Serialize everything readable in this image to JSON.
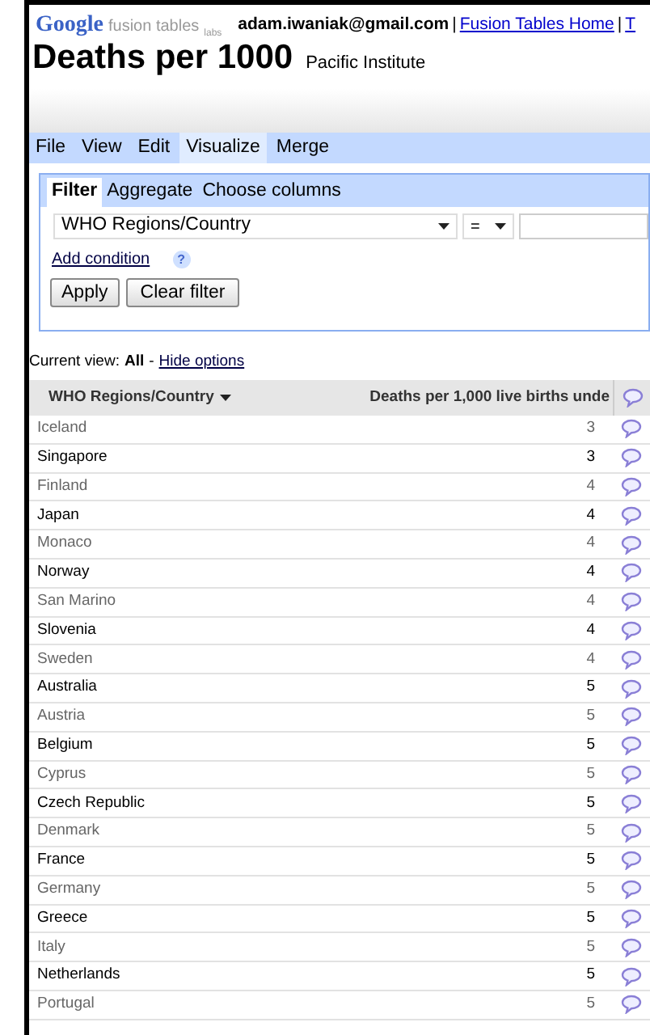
{
  "header": {
    "user": "adam.iwaniak@gmail.com",
    "separator": "|",
    "links": [
      "Fusion Tables Home",
      "T"
    ]
  },
  "logo": {
    "brand": "Google",
    "product": "fusion tables",
    "tag": "labs"
  },
  "title": "Deaths per 1000",
  "subtitle": "Pacific Institute",
  "menu": [
    {
      "label": "File",
      "selected": false
    },
    {
      "label": "View",
      "selected": false
    },
    {
      "label": "Edit",
      "selected": false
    },
    {
      "label": "Visualize",
      "selected": true
    },
    {
      "label": "Merge",
      "selected": false
    }
  ],
  "options_tabs": [
    {
      "label": "Filter",
      "selected": true
    },
    {
      "label": "Aggregate",
      "selected": false
    },
    {
      "label": "Choose columns",
      "selected": false
    }
  ],
  "filter": {
    "column": "WHO Regions/Country",
    "operator": "=",
    "add_condition": "Add condition",
    "help": "?",
    "apply": "Apply",
    "clear": "Clear filter"
  },
  "current_view": {
    "label": "Current view:",
    "value": "All",
    "separator": "-",
    "hide": "Hide options"
  },
  "table": {
    "columns": [
      "WHO Regions/Country",
      "Deaths per 1,000 live births unde"
    ],
    "rows": [
      [
        "Iceland",
        "3"
      ],
      [
        "Singapore",
        "3"
      ],
      [
        "Finland",
        "4"
      ],
      [
        "Japan",
        "4"
      ],
      [
        "Monaco",
        "4"
      ],
      [
        "Norway",
        "4"
      ],
      [
        "San Marino",
        "4"
      ],
      [
        "Slovenia",
        "4"
      ],
      [
        "Sweden",
        "4"
      ],
      [
        "Australia",
        "5"
      ],
      [
        "Austria",
        "5"
      ],
      [
        "Belgium",
        "5"
      ],
      [
        "Cyprus",
        "5"
      ],
      [
        "Czech Republic",
        "5"
      ],
      [
        "Denmark",
        "5"
      ],
      [
        "France",
        "5"
      ],
      [
        "Germany",
        "5"
      ],
      [
        "Greece",
        "5"
      ],
      [
        "Italy",
        "5"
      ],
      [
        "Netherlands",
        "5"
      ],
      [
        "Portugal",
        "5"
      ]
    ]
  }
}
